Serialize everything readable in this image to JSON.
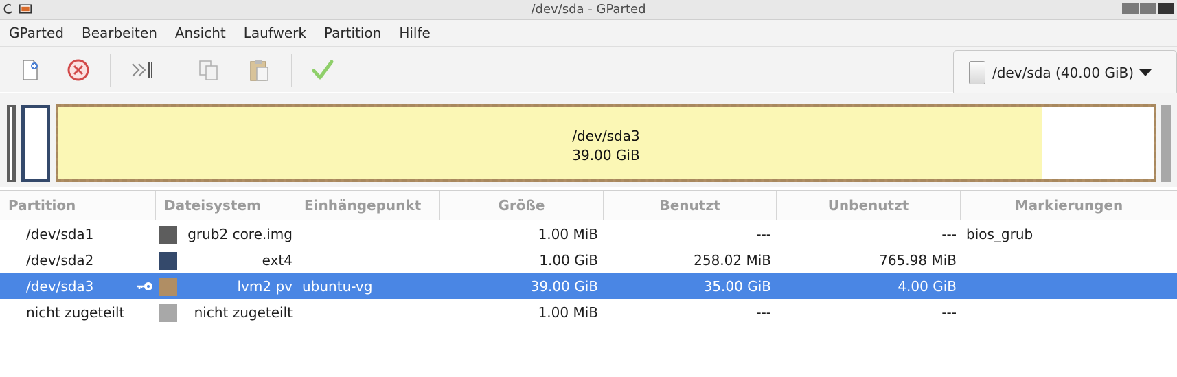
{
  "window": {
    "title": "/dev/sda - GParted"
  },
  "menu": [
    "GParted",
    "Bearbeiten",
    "Ansicht",
    "Laufwerk",
    "Partition",
    "Hilfe"
  ],
  "toolbar": {
    "buttons": [
      "new-icon",
      "delete-icon",
      "resize-move-icon",
      "copy-icon",
      "paste-icon",
      "apply-icon"
    ]
  },
  "device": {
    "label": "/dev/sda (40.00 GiB)"
  },
  "diskmap": {
    "sda3_name": "/dev/sda3",
    "sda3_size": "39.00 GiB"
  },
  "table": {
    "headers": [
      "Partition",
      "Dateisystem",
      "Einhängepunkt",
      "Größe",
      "Benutzt",
      "Unbenutzt",
      "Markierungen"
    ],
    "rows": [
      {
        "partition": "/dev/sda1",
        "fs": "grub2 core.img",
        "color": "#5d5d5d",
        "mount": "",
        "size": "1.00 MiB",
        "used": "---",
        "unused": "---",
        "flags": "bios_grub"
      },
      {
        "partition": "/dev/sda2",
        "fs": "ext4",
        "color": "#34496b",
        "mount": "",
        "size": "1.00 GiB",
        "used": "258.02 MiB",
        "unused": "765.98 MiB",
        "flags": ""
      },
      {
        "partition": "/dev/sda3",
        "fs": "lvm2 pv",
        "color": "#b08e64",
        "mount": "ubuntu-vg",
        "size": "39.00 GiB",
        "used": "35.00 GiB",
        "unused": "4.00 GiB",
        "flags": ""
      },
      {
        "partition": "nicht zugeteilt",
        "fs": "nicht zugeteilt",
        "color": "#a8a8a8",
        "mount": "",
        "size": "1.00 MiB",
        "used": "---",
        "unused": "---",
        "flags": ""
      }
    ]
  }
}
